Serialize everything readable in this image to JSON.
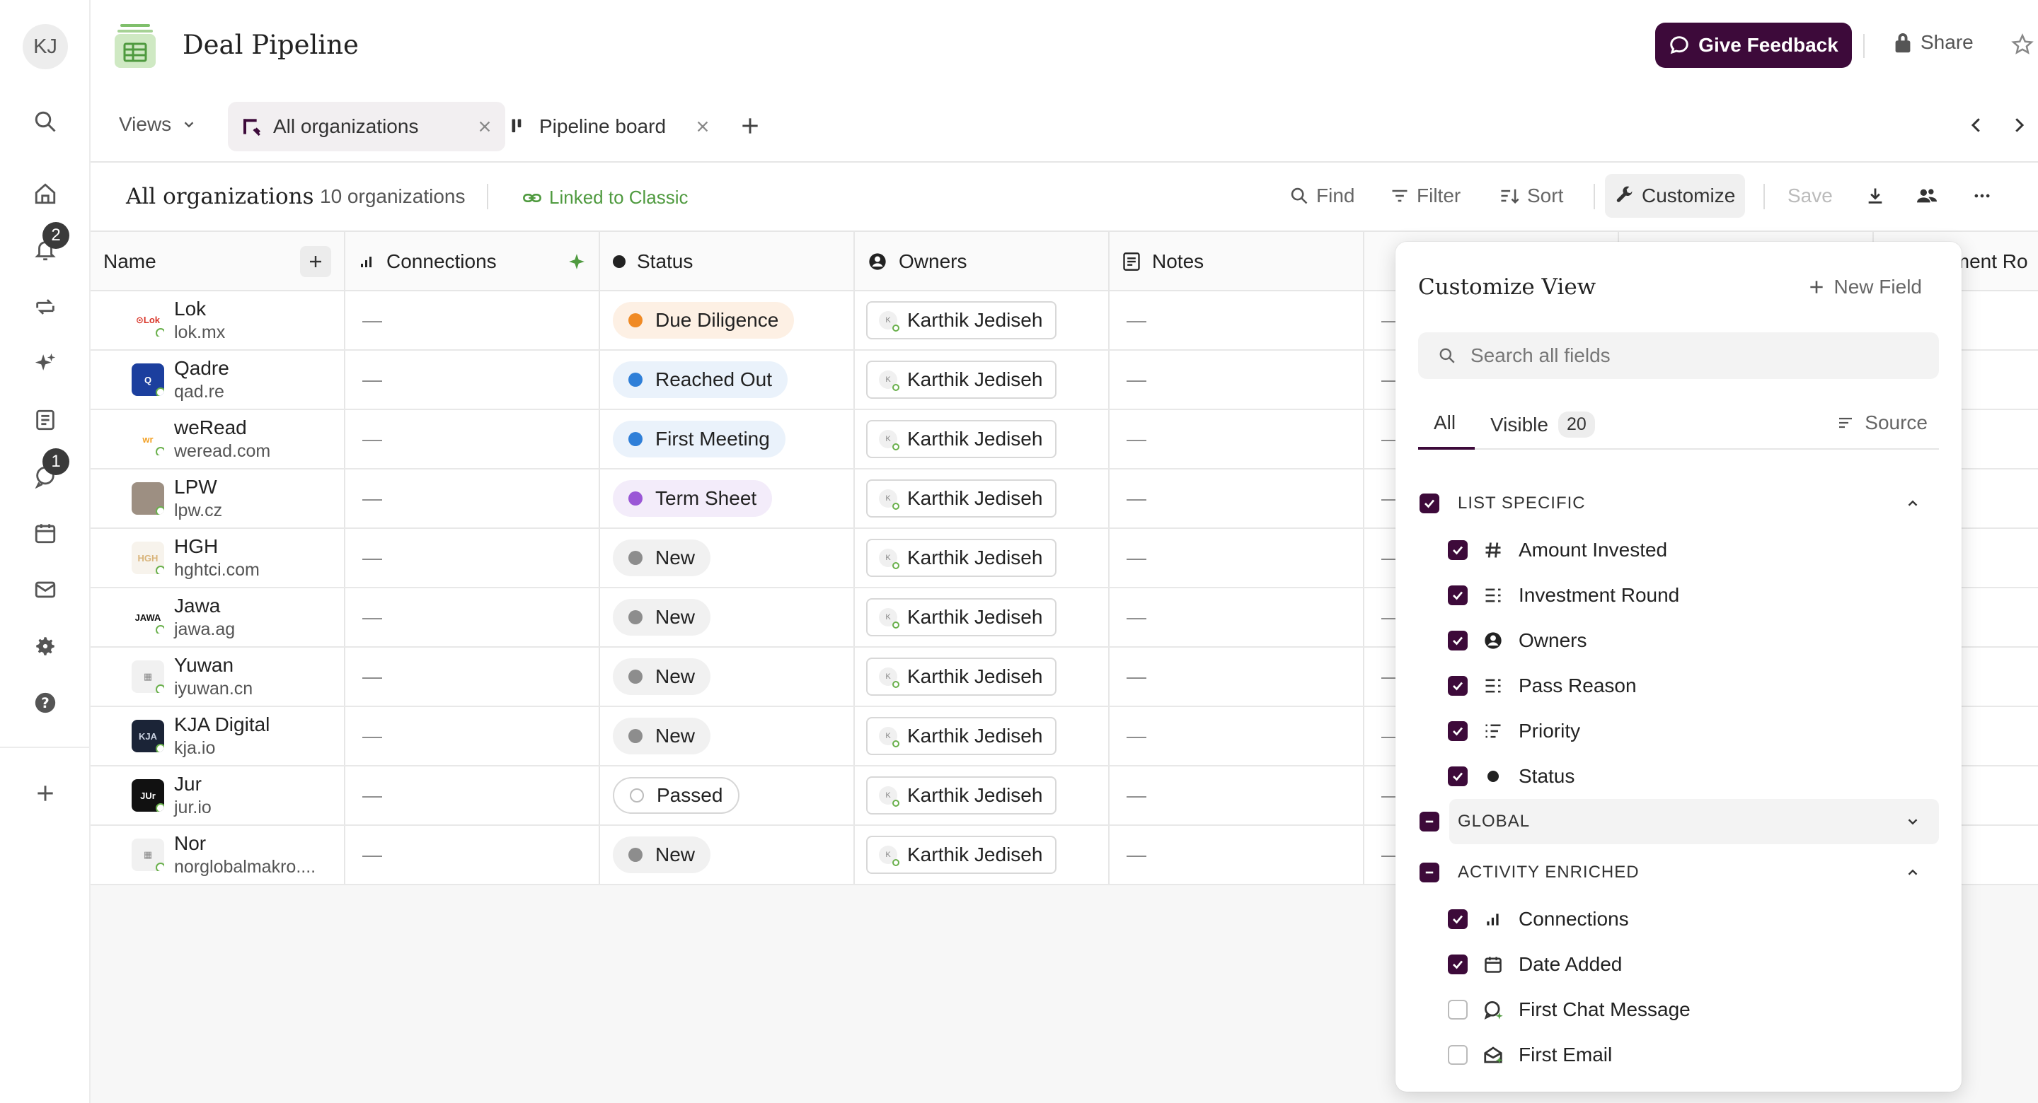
{
  "user": {
    "initials": "KJ"
  },
  "rail": {
    "notifications_badge": "2",
    "chat_badge": "1"
  },
  "header": {
    "title": "Deal Pipeline",
    "feedback_label": "Give Feedback",
    "share_label": "Share"
  },
  "tabs": {
    "views_label": "Views",
    "items": [
      {
        "label": "All organizations"
      },
      {
        "label": "Pipeline board"
      }
    ]
  },
  "toolbar": {
    "list_title": "All organizations",
    "count": "10 organizations",
    "linked": "Linked to Classic",
    "find": "Find",
    "filter": "Filter",
    "sort": "Sort",
    "customize": "Customize",
    "save": "Save"
  },
  "table": {
    "columns": [
      "Name",
      "Connections",
      "Status",
      "Owners",
      "Notes",
      "stment Ro"
    ],
    "rows": [
      {
        "name": "Lok",
        "domain": "lok.mx",
        "logo_text": "⊙Lok",
        "logo_bg": "#ffffff",
        "logo_color": "#d9372b",
        "connections": "—",
        "status": "Due Diligence",
        "status_color": "#f08a24",
        "status_bg": "#fdf0e4",
        "owner": "Karthik Jedisеh",
        "notes": "—"
      },
      {
        "name": "Qadre",
        "domain": "qad.re",
        "logo_text": "Q",
        "logo_bg": "#1c3f9e",
        "logo_color": "#ffffff",
        "connections": "—",
        "status": "Reached Out",
        "status_color": "#2f7fd8",
        "status_bg": "#eaf2fb",
        "owner": "Karthik Jedisеh",
        "notes": "—"
      },
      {
        "name": "weRead",
        "domain": "weread.com",
        "logo_text": "wr",
        "logo_bg": "#ffffff",
        "logo_color": "#f2a024",
        "connections": "—",
        "status": "First Meeting",
        "status_color": "#2f7fd8",
        "status_bg": "#eaf2fb",
        "owner": "Karthik Jedisеh",
        "notes": "—"
      },
      {
        "name": "LPW",
        "domain": "lpw.cz",
        "logo_text": "",
        "logo_bg": "#9d8f82",
        "logo_color": "#ffffff",
        "connections": "—",
        "status": "Term Sheet",
        "status_color": "#9a57d6",
        "status_bg": "#f3ecfa",
        "owner": "Karthik Jedisеh",
        "notes": "—"
      },
      {
        "name": "HGH",
        "domain": "hghtci.com",
        "logo_text": "HGH",
        "logo_bg": "#f7f3ec",
        "logo_color": "#d9b47a",
        "connections": "—",
        "status": "New",
        "status_color": "#8d8d8d",
        "status_bg": "#f1f1f1",
        "owner": "Karthik Jedisеh",
        "notes": "—"
      },
      {
        "name": "Jawa",
        "domain": "jawa.ag",
        "logo_text": "JAWA",
        "logo_bg": "#ffffff",
        "logo_color": "#111111",
        "connections": "—",
        "status": "New",
        "status_color": "#8d8d8d",
        "status_bg": "#f1f1f1",
        "owner": "Karthik Jedisеh",
        "notes": "—"
      },
      {
        "name": "Yuwan",
        "domain": "iyuwan.cn",
        "logo_text": "▦",
        "logo_bg": "#f1f1f1",
        "logo_color": "#888888",
        "connections": "—",
        "status": "New",
        "status_color": "#8d8d8d",
        "status_bg": "#f1f1f1",
        "owner": "Karthik Jedisеh",
        "notes": "—"
      },
      {
        "name": "KJA Digital",
        "domain": "kja.io",
        "logo_text": "KJA",
        "logo_bg": "#1b2437",
        "logo_color": "#c9d1e0",
        "connections": "—",
        "status": "New",
        "status_color": "#8d8d8d",
        "status_bg": "#f1f1f1",
        "owner": "Karthik Jedisеh",
        "notes": "—"
      },
      {
        "name": "Jur",
        "domain": "jur.io",
        "logo_text": "JUr",
        "logo_bg": "#111111",
        "logo_color": "#ffffff",
        "connections": "—",
        "status": "Passed",
        "status_color": "outline",
        "status_bg": "#ffffff",
        "owner": "Karthik Jedisеh",
        "notes": "—"
      },
      {
        "name": "Nor",
        "domain": "norglobalmakro....",
        "logo_text": "▦",
        "logo_bg": "#f1f1f1",
        "logo_color": "#888888",
        "connections": "—",
        "status": "New",
        "status_color": "#8d8d8d",
        "status_bg": "#f1f1f1",
        "owner": "Karthik Jedisеh",
        "notes": "—"
      }
    ]
  },
  "customize": {
    "title": "Customize View",
    "new_field": "New Field",
    "search_placeholder": "Search all fields",
    "tab_all": "All",
    "tab_visible": "Visible",
    "visible_count": "20",
    "source": "Source",
    "groups": {
      "list_specific": "LIST SPECIFIC",
      "global": "GLOBAL",
      "activity_enriched": "ACTIVITY ENRICHED"
    },
    "list_specific_fields": [
      {
        "label": "Amount Invested",
        "icon": "hash-icon",
        "checked": true
      },
      {
        "label": "Investment Round",
        "icon": "select-list-icon",
        "checked": true
      },
      {
        "label": "Owners",
        "icon": "person-icon",
        "checked": true
      },
      {
        "label": "Pass Reason",
        "icon": "select-list-icon",
        "checked": true
      },
      {
        "label": "Priority",
        "icon": "priority-list-icon",
        "checked": true
      },
      {
        "label": "Status",
        "icon": "status-dot-icon",
        "checked": true
      }
    ],
    "activity_fields": [
      {
        "label": "Connections",
        "icon": "signal-bars-icon",
        "checked": true
      },
      {
        "label": "Date Added",
        "icon": "calendar-icon",
        "checked": true
      },
      {
        "label": "First Chat Message",
        "icon": "chat-icon",
        "checked": false
      },
      {
        "label": "First Email",
        "icon": "email-icon",
        "checked": false
      }
    ]
  },
  "colors": {
    "brand": "#3d0a3a",
    "linked_green": "#4f9a3f"
  }
}
